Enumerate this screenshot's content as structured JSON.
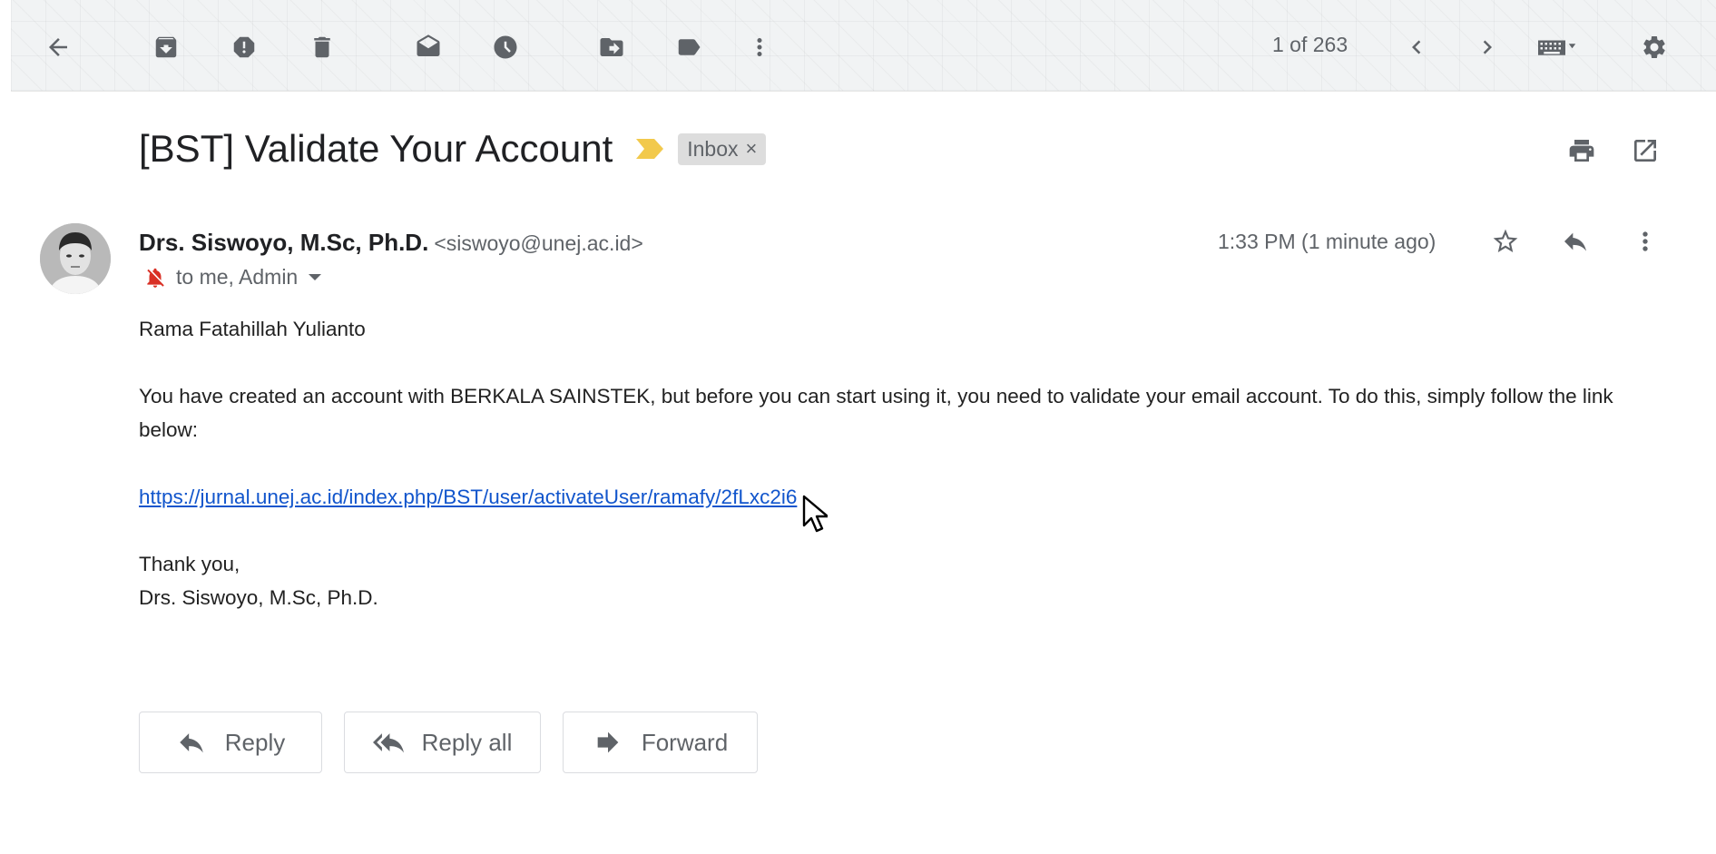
{
  "toolbar": {
    "pager_text": "1 of 263"
  },
  "email": {
    "subject": "[BST] Validate Your Account",
    "label": "Inbox",
    "label_remove": "×",
    "sender_name": "Drs. Siswoyo, M.Sc, Ph.D.",
    "sender_email": "<siswoyo@unej.ac.id>",
    "recipients": "to me, Admin",
    "time": "1:33 PM (1 minute ago)",
    "body": {
      "greeting": "Rama Fatahillah Yulianto",
      "message": "You have created an account with BERKALA SAINSTEK, but before you can start using it, you need to validate your email account. To do this, simply follow the link below:",
      "link": "https://jurnal.unej.ac.id/index.php/BST/user/activateUser/ramafy/2fLxc2i6",
      "closing": "Thank you,",
      "signature": "Drs. Siswoyo, M.Sc, Ph.D."
    }
  },
  "actions": {
    "reply": "Reply",
    "reply_all": "Reply all",
    "forward": "Forward"
  },
  "colors": {
    "link": "#1155cc",
    "important_marker": "#f2c94c",
    "mute_icon": "#d93025"
  }
}
